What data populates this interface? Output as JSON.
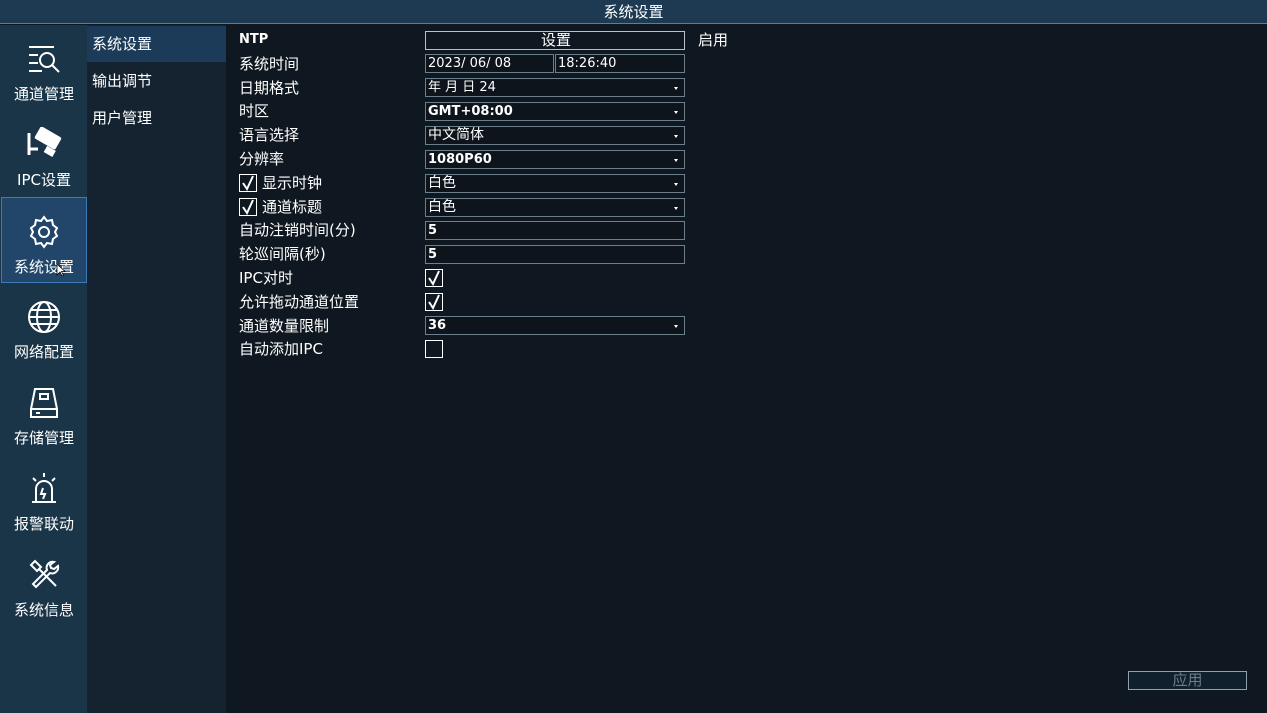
{
  "window": {
    "title": "系统设置"
  },
  "nav": [
    {
      "label": "通道管理",
      "icon": "channel-search-icon"
    },
    {
      "label": "IPC设置",
      "icon": "camera-icon"
    },
    {
      "label": "系统设置",
      "icon": "gear-icon"
    },
    {
      "label": "网络配置",
      "icon": "globe-icon"
    },
    {
      "label": "存储管理",
      "icon": "storage-icon"
    },
    {
      "label": "报警联动",
      "icon": "alarm-icon"
    },
    {
      "label": "系统信息",
      "icon": "tools-icon"
    }
  ],
  "active_nav": "系统设置",
  "submenu": [
    {
      "label": "系统设置"
    },
    {
      "label": "输出调节"
    },
    {
      "label": "用户管理"
    }
  ],
  "form": {
    "ntp": {
      "label": "NTP",
      "button": "设置",
      "status": "启用"
    },
    "system_time": {
      "label": "系统时间",
      "date": "2023/ 06/ 08",
      "time": "18:26:40"
    },
    "date_format": {
      "label": "日期格式",
      "value": "年 月 日 24"
    },
    "timezone": {
      "label": "时区",
      "value": "GMT+08:00"
    },
    "language": {
      "label": "语言选择",
      "value": "中文简体"
    },
    "resolution": {
      "label": "分辨率",
      "value": "1080P60"
    },
    "show_clock": {
      "label": "显示时钟",
      "checked": true,
      "value": "白色"
    },
    "channel_title": {
      "label": "通道标题",
      "checked": true,
      "value": "白色"
    },
    "auto_logout": {
      "label": "自动注销时间(分)",
      "value": "5"
    },
    "patrol_interval": {
      "label": "轮巡间隔(秒)",
      "value": "5"
    },
    "ipc_timesync": {
      "label": "IPC对时",
      "checked": true
    },
    "allow_drag": {
      "label": "允许拖动通道位置",
      "checked": true
    },
    "channel_limit": {
      "label": "通道数量限制",
      "value": "36"
    },
    "auto_add_ipc": {
      "label": "自动添加IPC",
      "checked": false
    }
  },
  "footer": {
    "apply_label": "应用"
  },
  "colors": {
    "accent": "#3f7ab8",
    "panel": "#1a3448",
    "background": "#0f1820"
  }
}
